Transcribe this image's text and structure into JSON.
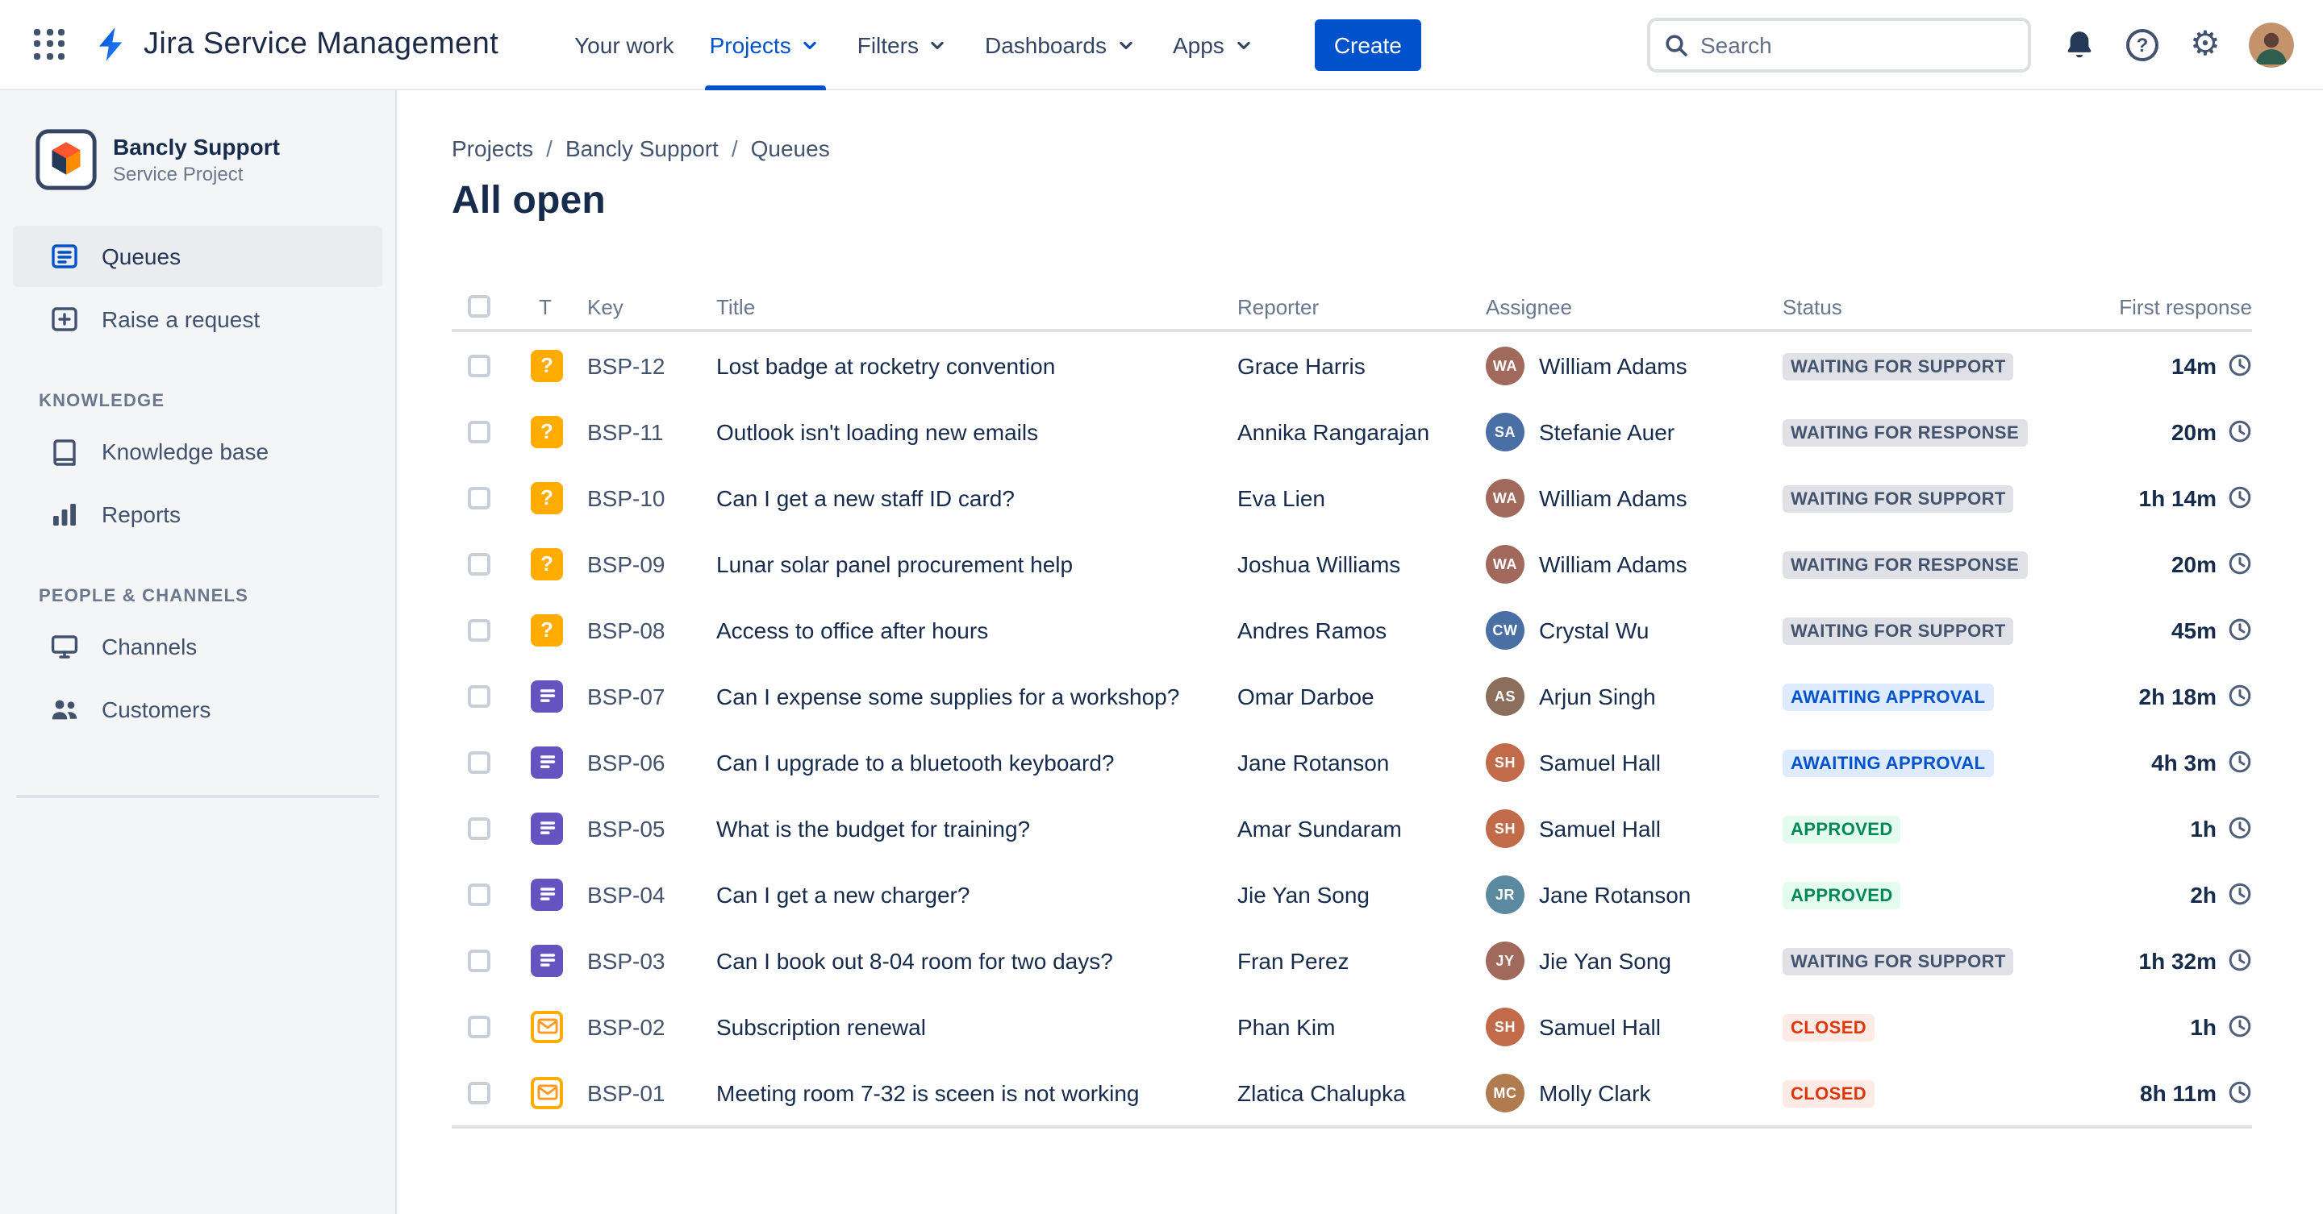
{
  "topbar": {
    "app_name": "Jira Service Management",
    "nav": [
      {
        "label": "Your work",
        "dropdown": false,
        "active": false
      },
      {
        "label": "Projects",
        "dropdown": true,
        "active": true
      },
      {
        "label": "Filters",
        "dropdown": true,
        "active": false
      },
      {
        "label": "Dashboards",
        "dropdown": true,
        "active": false
      },
      {
        "label": "Apps",
        "dropdown": true,
        "active": false
      }
    ],
    "create_label": "Create",
    "search_placeholder": "Search"
  },
  "sidebar": {
    "project_name": "Bancly Support",
    "project_type": "Service Project",
    "menu": [
      {
        "label": "Queues",
        "icon": "queues",
        "active": true
      },
      {
        "label": "Raise a request",
        "icon": "raise-request",
        "active": false
      }
    ],
    "sections": [
      {
        "heading": "Knowledge",
        "items": [
          {
            "label": "Knowledge base",
            "icon": "book",
            "active": false
          },
          {
            "label": "Reports",
            "icon": "bar-chart",
            "active": false
          }
        ]
      },
      {
        "heading": "People & channels",
        "items": [
          {
            "label": "Channels",
            "icon": "monitor",
            "active": false
          },
          {
            "label": "Customers",
            "icon": "people",
            "active": false
          }
        ]
      }
    ]
  },
  "main": {
    "breadcrumb": [
      "Projects",
      "Bancly Support",
      "Queues"
    ],
    "title": "All open",
    "table": {
      "headers": {
        "type": "T",
        "key": "Key",
        "title": "Title",
        "reporter": "Reporter",
        "assignee": "Assignee",
        "status": "Status",
        "first_response": "First response"
      },
      "rows": [
        {
          "key": "BSP-12",
          "type": "question",
          "title": "Lost badge at rocketry convention",
          "reporter": "Grace Harris",
          "assignee": "William Adams",
          "status": "Waiting for support",
          "status_type": "default",
          "first_response": "14m"
        },
        {
          "key": "BSP-11",
          "type": "question",
          "title": "Outlook isn't loading new emails",
          "reporter": "Annika Rangarajan",
          "assignee": "Stefanie Auer",
          "status": "Waiting for response",
          "status_type": "default",
          "first_response": "20m"
        },
        {
          "key": "BSP-10",
          "type": "question",
          "title": "Can I get a new staff ID card?",
          "reporter": "Eva Lien",
          "assignee": "William Adams",
          "status": "Waiting for support",
          "status_type": "default",
          "first_response": "1h 14m"
        },
        {
          "key": "BSP-09",
          "type": "question",
          "title": "Lunar solar panel procurement help",
          "reporter": "Joshua Williams",
          "assignee": "William Adams",
          "status": "Waiting for response",
          "status_type": "default",
          "first_response": "20m"
        },
        {
          "key": "BSP-08",
          "type": "question",
          "title": "Access to office after hours",
          "reporter": "Andres Ramos",
          "assignee": "Crystal Wu",
          "status": "Waiting for support",
          "status_type": "default",
          "first_response": "45m"
        },
        {
          "key": "BSP-07",
          "type": "service-request",
          "title": "Can I expense some supplies for a workshop?",
          "reporter": "Omar Darboe",
          "assignee": "Arjun Singh",
          "status": "Awaiting approval",
          "status_type": "inprogress",
          "first_response": "2h 18m"
        },
        {
          "key": "BSP-06",
          "type": "service-request",
          "title": "Can I upgrade to a bluetooth keyboard?",
          "reporter": "Jane Rotanson",
          "assignee": "Samuel Hall",
          "status": "Awaiting approval",
          "status_type": "inprogress",
          "first_response": "4h 3m"
        },
        {
          "key": "BSP-05",
          "type": "service-request",
          "title": "What is the budget for training?",
          "reporter": "Amar Sundaram",
          "assignee": "Samuel Hall",
          "status": "Approved",
          "status_type": "success",
          "first_response": "1h"
        },
        {
          "key": "BSP-04",
          "type": "service-request",
          "title": "Can I get a new charger?",
          "reporter": "Jie Yan Song",
          "assignee": "Jane Rotanson",
          "status": "Approved",
          "status_type": "success",
          "first_response": "2h"
        },
        {
          "key": "BSP-03",
          "type": "service-request",
          "title": "Can I book out 8-04 room for two days?",
          "reporter": "Fran Perez",
          "assignee": "Jie Yan Song",
          "status": "Waiting for support",
          "status_type": "default",
          "first_response": "1h 32m"
        },
        {
          "key": "BSP-02",
          "type": "email",
          "title": "Subscription renewal",
          "reporter": "Phan Kim",
          "assignee": "Samuel Hall",
          "status": "Closed",
          "status_type": "removed",
          "first_response": "1h"
        },
        {
          "key": "BSP-01",
          "type": "email",
          "title": "Meeting room 7-32 is sceen is not working",
          "reporter": "Zlatica Chalupka",
          "assignee": "Molly Clark",
          "status": "Closed",
          "status_type": "removed",
          "first_response": "8h 11m"
        }
      ]
    }
  },
  "colors": {
    "accent": "#0052CC",
    "type_icons": {
      "question": "#FFAB00",
      "service-request": "#6554C0",
      "email": "#FFAB00"
    },
    "status": {
      "default": {
        "bg": "#DFE1E6",
        "fg": "#44546F"
      },
      "inprogress": {
        "bg": "#DEEBFF",
        "fg": "#0052CC"
      },
      "success": {
        "bg": "#E3FCEF",
        "fg": "#00875A"
      },
      "removed": {
        "bg": "#FFEBE6",
        "fg": "#DE350B"
      }
    },
    "avatar_palette": [
      "#B07B4F",
      "#9C7BB0",
      "#C26B4A",
      "#7BA05B",
      "#4A6FA5",
      "#B05B7B",
      "#5B8AA0",
      "#A0695B",
      "#6B8E8E",
      "#8C6E5D"
    ]
  }
}
